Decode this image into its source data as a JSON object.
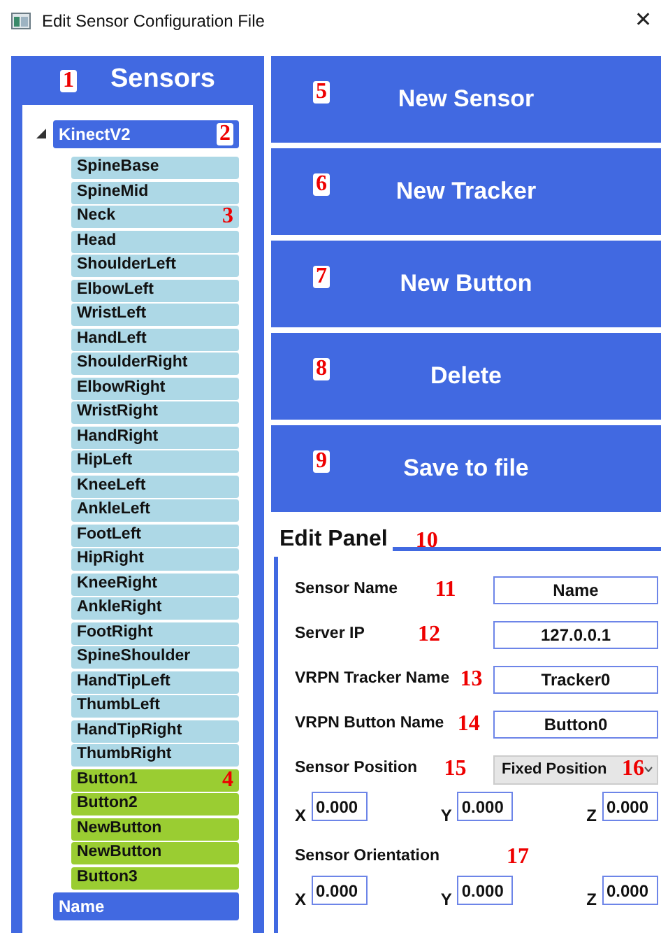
{
  "window": {
    "title": "Edit Sensor Configuration File",
    "close": "✕"
  },
  "sensors_panel": {
    "title": "Sensors",
    "marker": "1",
    "tree": [
      {
        "label": "KinectV2",
        "marker": "2",
        "expanded": true,
        "children": [
          {
            "label": "SpineBase",
            "kind": "joint"
          },
          {
            "label": "SpineMid",
            "kind": "joint"
          },
          {
            "label": "Neck",
            "kind": "joint",
            "marker": "3"
          },
          {
            "label": "Head",
            "kind": "joint"
          },
          {
            "label": "ShoulderLeft",
            "kind": "joint"
          },
          {
            "label": "ElbowLeft",
            "kind": "joint"
          },
          {
            "label": "WristLeft",
            "kind": "joint"
          },
          {
            "label": "HandLeft",
            "kind": "joint"
          },
          {
            "label": "ShoulderRight",
            "kind": "joint"
          },
          {
            "label": "ElbowRight",
            "kind": "joint"
          },
          {
            "label": "WristRight",
            "kind": "joint"
          },
          {
            "label": "HandRight",
            "kind": "joint"
          },
          {
            "label": "HipLeft",
            "kind": "joint"
          },
          {
            "label": "KneeLeft",
            "kind": "joint"
          },
          {
            "label": "AnkleLeft",
            "kind": "joint"
          },
          {
            "label": "FootLeft",
            "kind": "joint"
          },
          {
            "label": "HipRight",
            "kind": "joint"
          },
          {
            "label": "KneeRight",
            "kind": "joint"
          },
          {
            "label": "AnkleRight",
            "kind": "joint"
          },
          {
            "label": "FootRight",
            "kind": "joint"
          },
          {
            "label": "SpineShoulder",
            "kind": "joint"
          },
          {
            "label": "HandTipLeft",
            "kind": "joint"
          },
          {
            "label": "ThumbLeft",
            "kind": "joint"
          },
          {
            "label": "HandTipRight",
            "kind": "joint"
          },
          {
            "label": "ThumbRight",
            "kind": "joint"
          },
          {
            "label": "Button1",
            "kind": "button",
            "marker": "4"
          },
          {
            "label": "Button2",
            "kind": "button"
          },
          {
            "label": "NewButton",
            "kind": "button"
          },
          {
            "label": "NewButton",
            "kind": "button"
          },
          {
            "label": "Button3",
            "kind": "button"
          }
        ]
      },
      {
        "label": "Name"
      }
    ]
  },
  "buttons": [
    {
      "label": "New Sensor",
      "marker": "5"
    },
    {
      "label": "New Tracker",
      "marker": "6"
    },
    {
      "label": "New Button",
      "marker": "7"
    },
    {
      "label": "Delete",
      "marker": "8"
    },
    {
      "label": "Save to file",
      "marker": "9"
    }
  ],
  "edit_panel": {
    "title": "Edit Panel",
    "marker": "10",
    "fields": [
      {
        "label": "Sensor Name",
        "marker": "11",
        "value": "Name"
      },
      {
        "label": "Server IP",
        "marker": "12",
        "value": "127.0.0.1"
      },
      {
        "label": "VRPN Tracker Name",
        "marker": "13",
        "value": "Tracker0"
      },
      {
        "label": "VRPN Button Name",
        "marker": "14",
        "value": "Button0"
      }
    ],
    "position": {
      "label": "Sensor Position",
      "marker": "15",
      "dropdown": {
        "value": "Fixed Position",
        "marker": "16"
      },
      "coords": [
        {
          "axis": "X",
          "value": "0.000"
        },
        {
          "axis": "Y",
          "value": "0.000"
        },
        {
          "axis": "Z",
          "value": "0.000"
        }
      ]
    },
    "orientation": {
      "label": "Sensor Orientation",
      "marker": "17",
      "coords": [
        {
          "axis": "X",
          "value": "0.000"
        },
        {
          "axis": "Y",
          "value": "0.000"
        },
        {
          "axis": "Z",
          "value": "0.000"
        }
      ]
    }
  }
}
